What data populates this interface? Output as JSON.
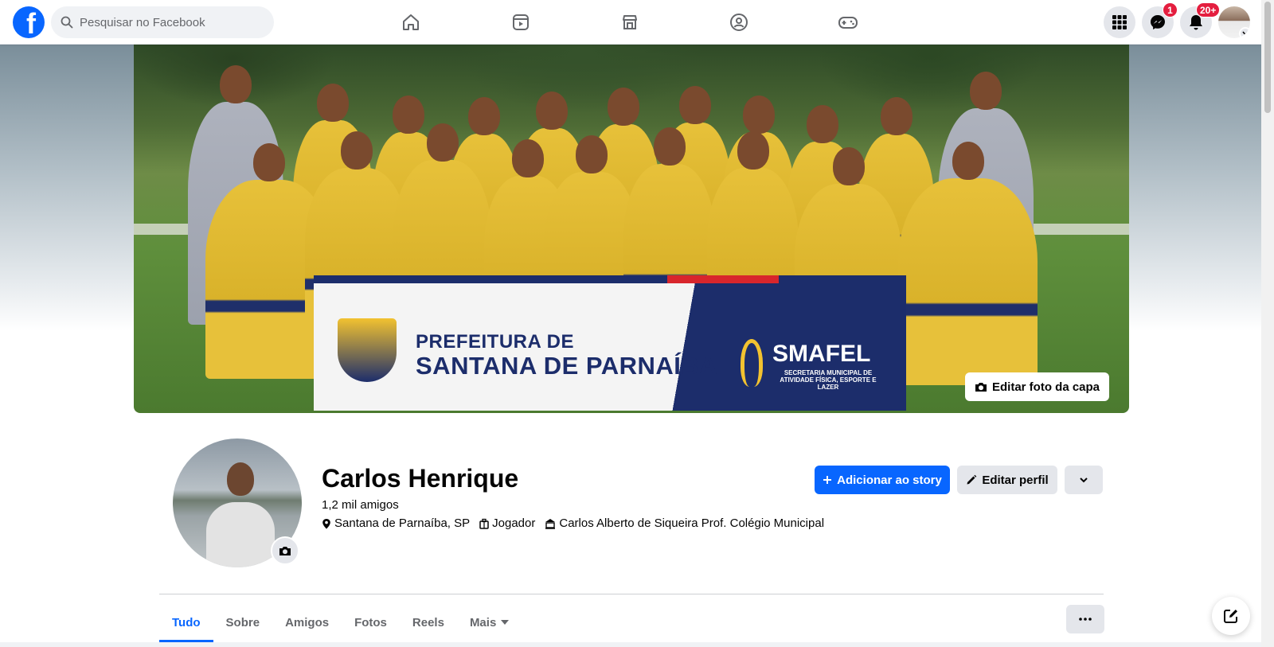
{
  "search": {
    "placeholder": "Pesquisar no Facebook"
  },
  "nav": {
    "tabs": [
      "home",
      "reels",
      "marketplace",
      "groups",
      "gaming"
    ]
  },
  "header_right": {
    "messenger_badge": "1",
    "notifications_badge": "20+"
  },
  "cover": {
    "banner_line1": "PREFEITURA DE",
    "banner_line2": "SANTANA DE PARNAÍBA",
    "banner_brand": "SMAFEL",
    "banner_brand_sub": "SECRETARIA MUNICIPAL DE ATIVIDADE FÍSICA, ESPORTE E LAZER",
    "edit_label": "Editar foto da capa"
  },
  "profile": {
    "name": "Carlos Henrique",
    "friends": "1,2 mil amigos",
    "location": "Santana de Parnaíba, SP",
    "work": "Jogador",
    "education": "Carlos Alberto de Siqueira Prof. Colégio Municipal"
  },
  "actions": {
    "add_story": "Adicionar ao story",
    "edit_profile": "Editar perfil"
  },
  "tabs": [
    {
      "label": "Tudo",
      "active": true
    },
    {
      "label": "Sobre"
    },
    {
      "label": "Amigos"
    },
    {
      "label": "Fotos"
    },
    {
      "label": "Reels"
    },
    {
      "label": "Mais"
    }
  ],
  "colors": {
    "brand": "#0866ff",
    "badge": "#e41e3f",
    "secondary_button": "#e4e6eb"
  }
}
